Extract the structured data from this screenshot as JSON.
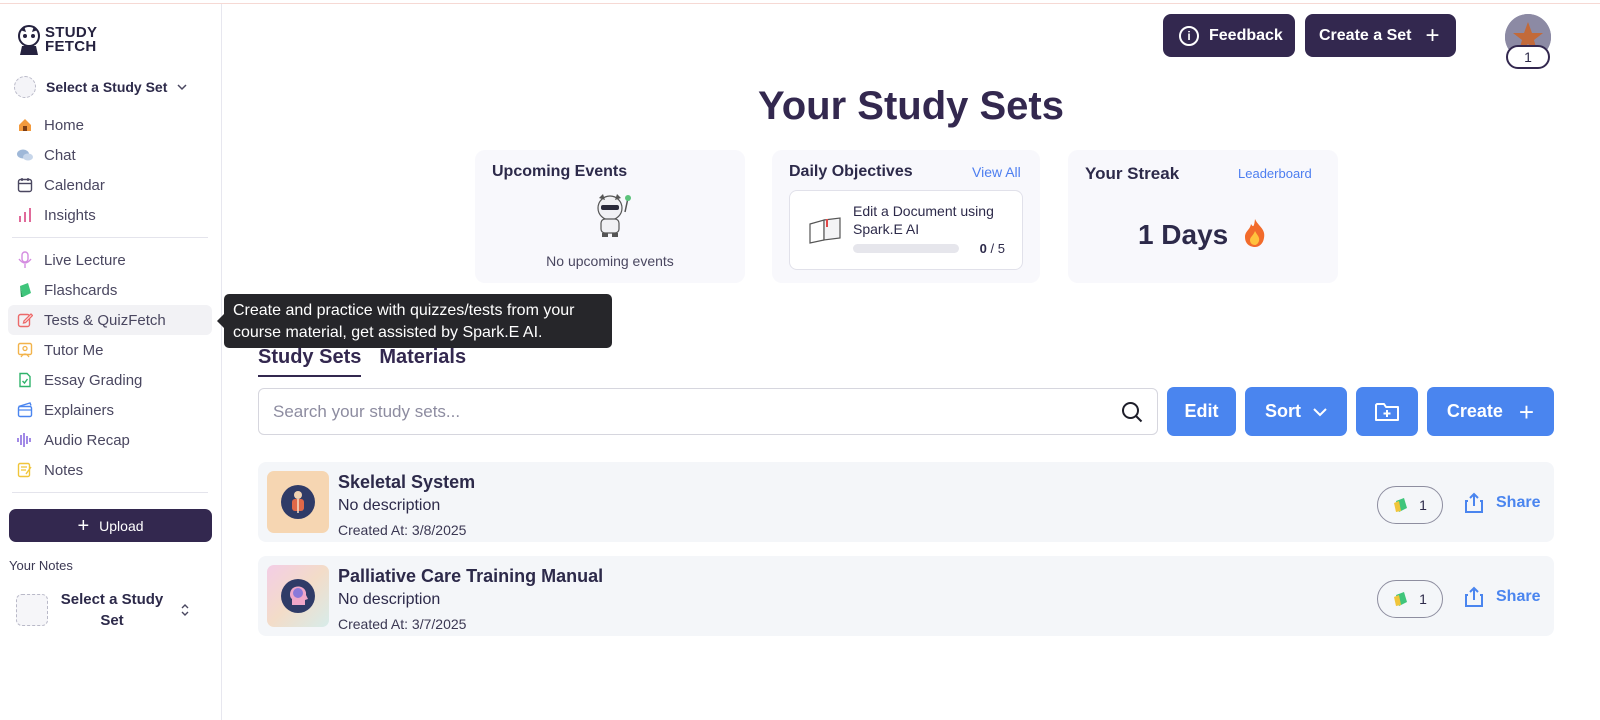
{
  "sidebar": {
    "logo_line1": "STUDY",
    "logo_line2": "FETCH",
    "set_select_label": "Select a Study Set",
    "nav_group1": [
      {
        "label": "Home",
        "icon": "home-icon"
      },
      {
        "label": "Chat",
        "icon": "chat-icon"
      },
      {
        "label": "Calendar",
        "icon": "calendar-icon"
      },
      {
        "label": "Insights",
        "icon": "insights-icon"
      }
    ],
    "nav_group2": [
      {
        "label": "Live Lecture",
        "icon": "microphone-icon"
      },
      {
        "label": "Flashcards",
        "icon": "flashcards-icon"
      },
      {
        "label": "Tests & QuizFetch",
        "icon": "edit-icon"
      },
      {
        "label": "Tutor Me",
        "icon": "tutor-icon"
      },
      {
        "label": "Essay Grading",
        "icon": "essay-icon"
      },
      {
        "label": "Explainers",
        "icon": "explainers-icon"
      },
      {
        "label": "Audio Recap",
        "icon": "audio-wave-icon"
      },
      {
        "label": "Notes",
        "icon": "notes-icon"
      }
    ],
    "upload_label": "Upload",
    "your_notes_label": "Your Notes",
    "notes_select_label": "Select a Study Set"
  },
  "tooltip": {
    "text": "Create and practice with quizzes/tests from your course material, get assisted by Spark.E AI."
  },
  "header": {
    "feedback_label": "Feedback",
    "create_set_label": "Create a Set",
    "profile_badge": "1"
  },
  "main": {
    "title": "Your Study Sets",
    "upcoming": {
      "title": "Upcoming Events",
      "empty_text": "No upcoming events"
    },
    "daily": {
      "title": "Daily Objectives",
      "link": "View All",
      "objective_text": "Edit a Document using Spark.E AI",
      "progress_done": "0",
      "progress_total": "/ 5"
    },
    "streak": {
      "title": "Your Streak",
      "link": "Leaderboard",
      "value": "1 Days"
    },
    "tabs": [
      "Study Sets",
      "Materials"
    ],
    "search_placeholder": "Search your study sets...",
    "buttons": {
      "edit": "Edit",
      "sort": "Sort",
      "create": "Create"
    },
    "sets": [
      {
        "name": "Skeletal System",
        "description": "No description",
        "created": "Created At: 3/8/2025",
        "flashcard_count": "1",
        "share_label": "Share"
      },
      {
        "name": "Palliative Care Training Manual",
        "description": "No description",
        "created": "Created At: 3/7/2025",
        "flashcard_count": "1",
        "share_label": "Share"
      }
    ]
  },
  "colors": {
    "brand_dark": "#33284f",
    "accent_blue": "#4a85ef",
    "link_blue": "#4d7ef0"
  }
}
